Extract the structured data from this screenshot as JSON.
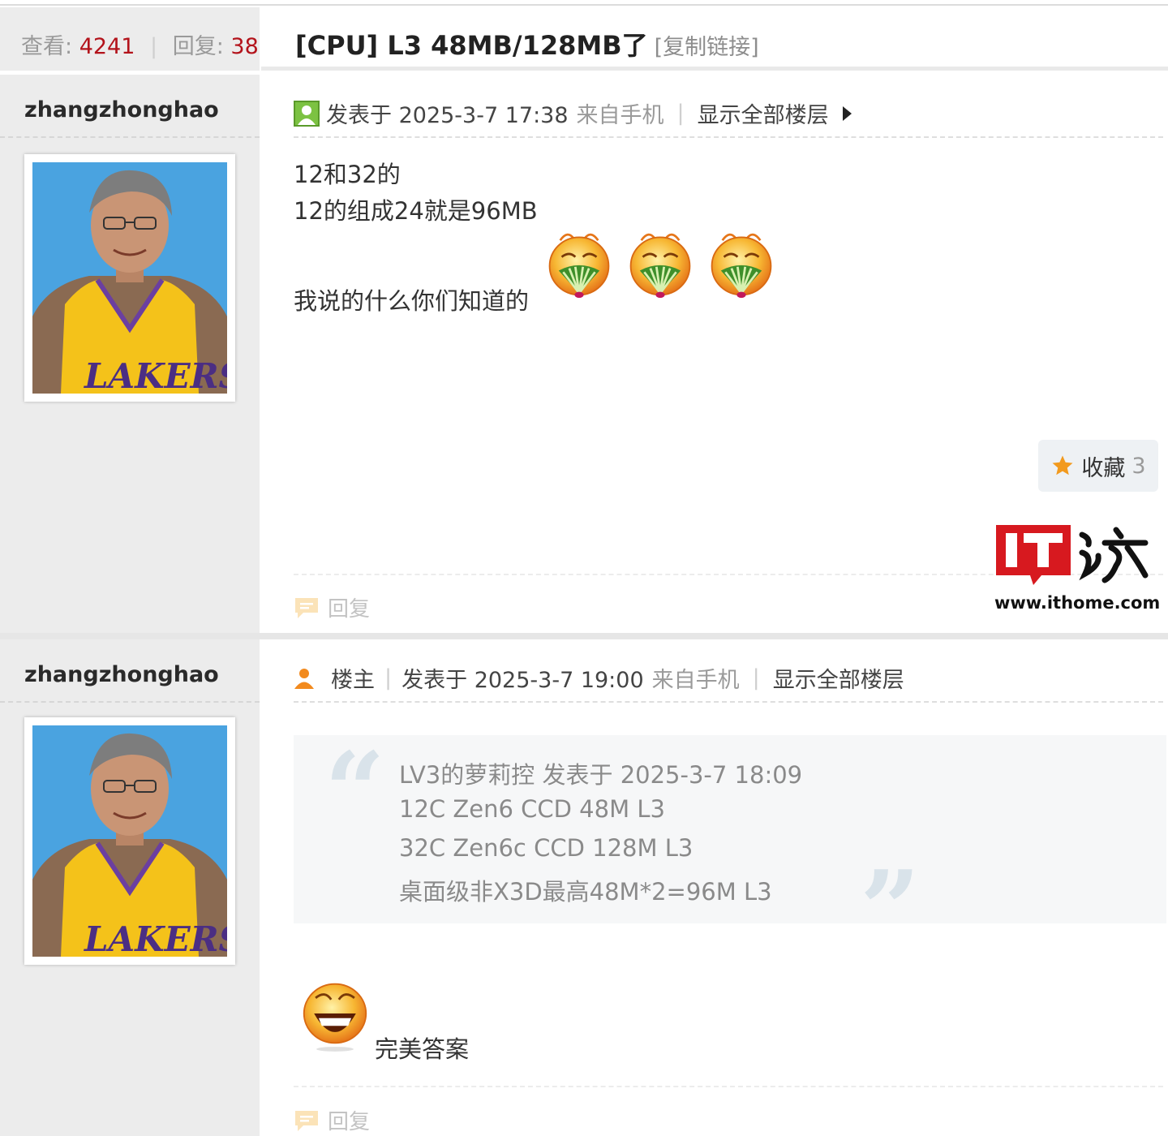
{
  "thread": {
    "views_label": "查看:",
    "views": "4241",
    "replies_label": "回复:",
    "replies": "38",
    "title": "[CPU] L3 48MB/128MB了",
    "copy_link": "[复制链接]"
  },
  "posts": [
    {
      "username": "zhangzhonghao",
      "posted_label": "发表于 2025-3-7 17:38",
      "source": "来自手机",
      "show_all": "显示全部楼层",
      "lines": [
        "12和32的",
        "12的组成24就是96MB",
        "我说的什么你们知道的"
      ],
      "favorite_label": "收藏",
      "favorite_count": "3",
      "reply_label": "回复"
    },
    {
      "username": "zhangzhonghao",
      "role": "楼主",
      "posted_label": "发表于 2025-3-7 19:00",
      "source": "来自手机",
      "show_all": "显示全部楼层",
      "quote": {
        "header": "LV3的萝莉控 发表于 2025-3-7 18:09",
        "lines": [
          "12C Zen6 CCD 48M L3",
          "32C Zen6c CCD 128M L3",
          "桌面级非X3D最高48M*2=96M L3"
        ]
      },
      "reply_text": "完美答案",
      "reply_label": "回复"
    }
  ],
  "watermark": {
    "url": "www.ithome.com"
  },
  "colors": {
    "accent_red": "#b3131b",
    "sidebar_bg": "#ececec",
    "emoji_orange": "#f29a1e"
  }
}
